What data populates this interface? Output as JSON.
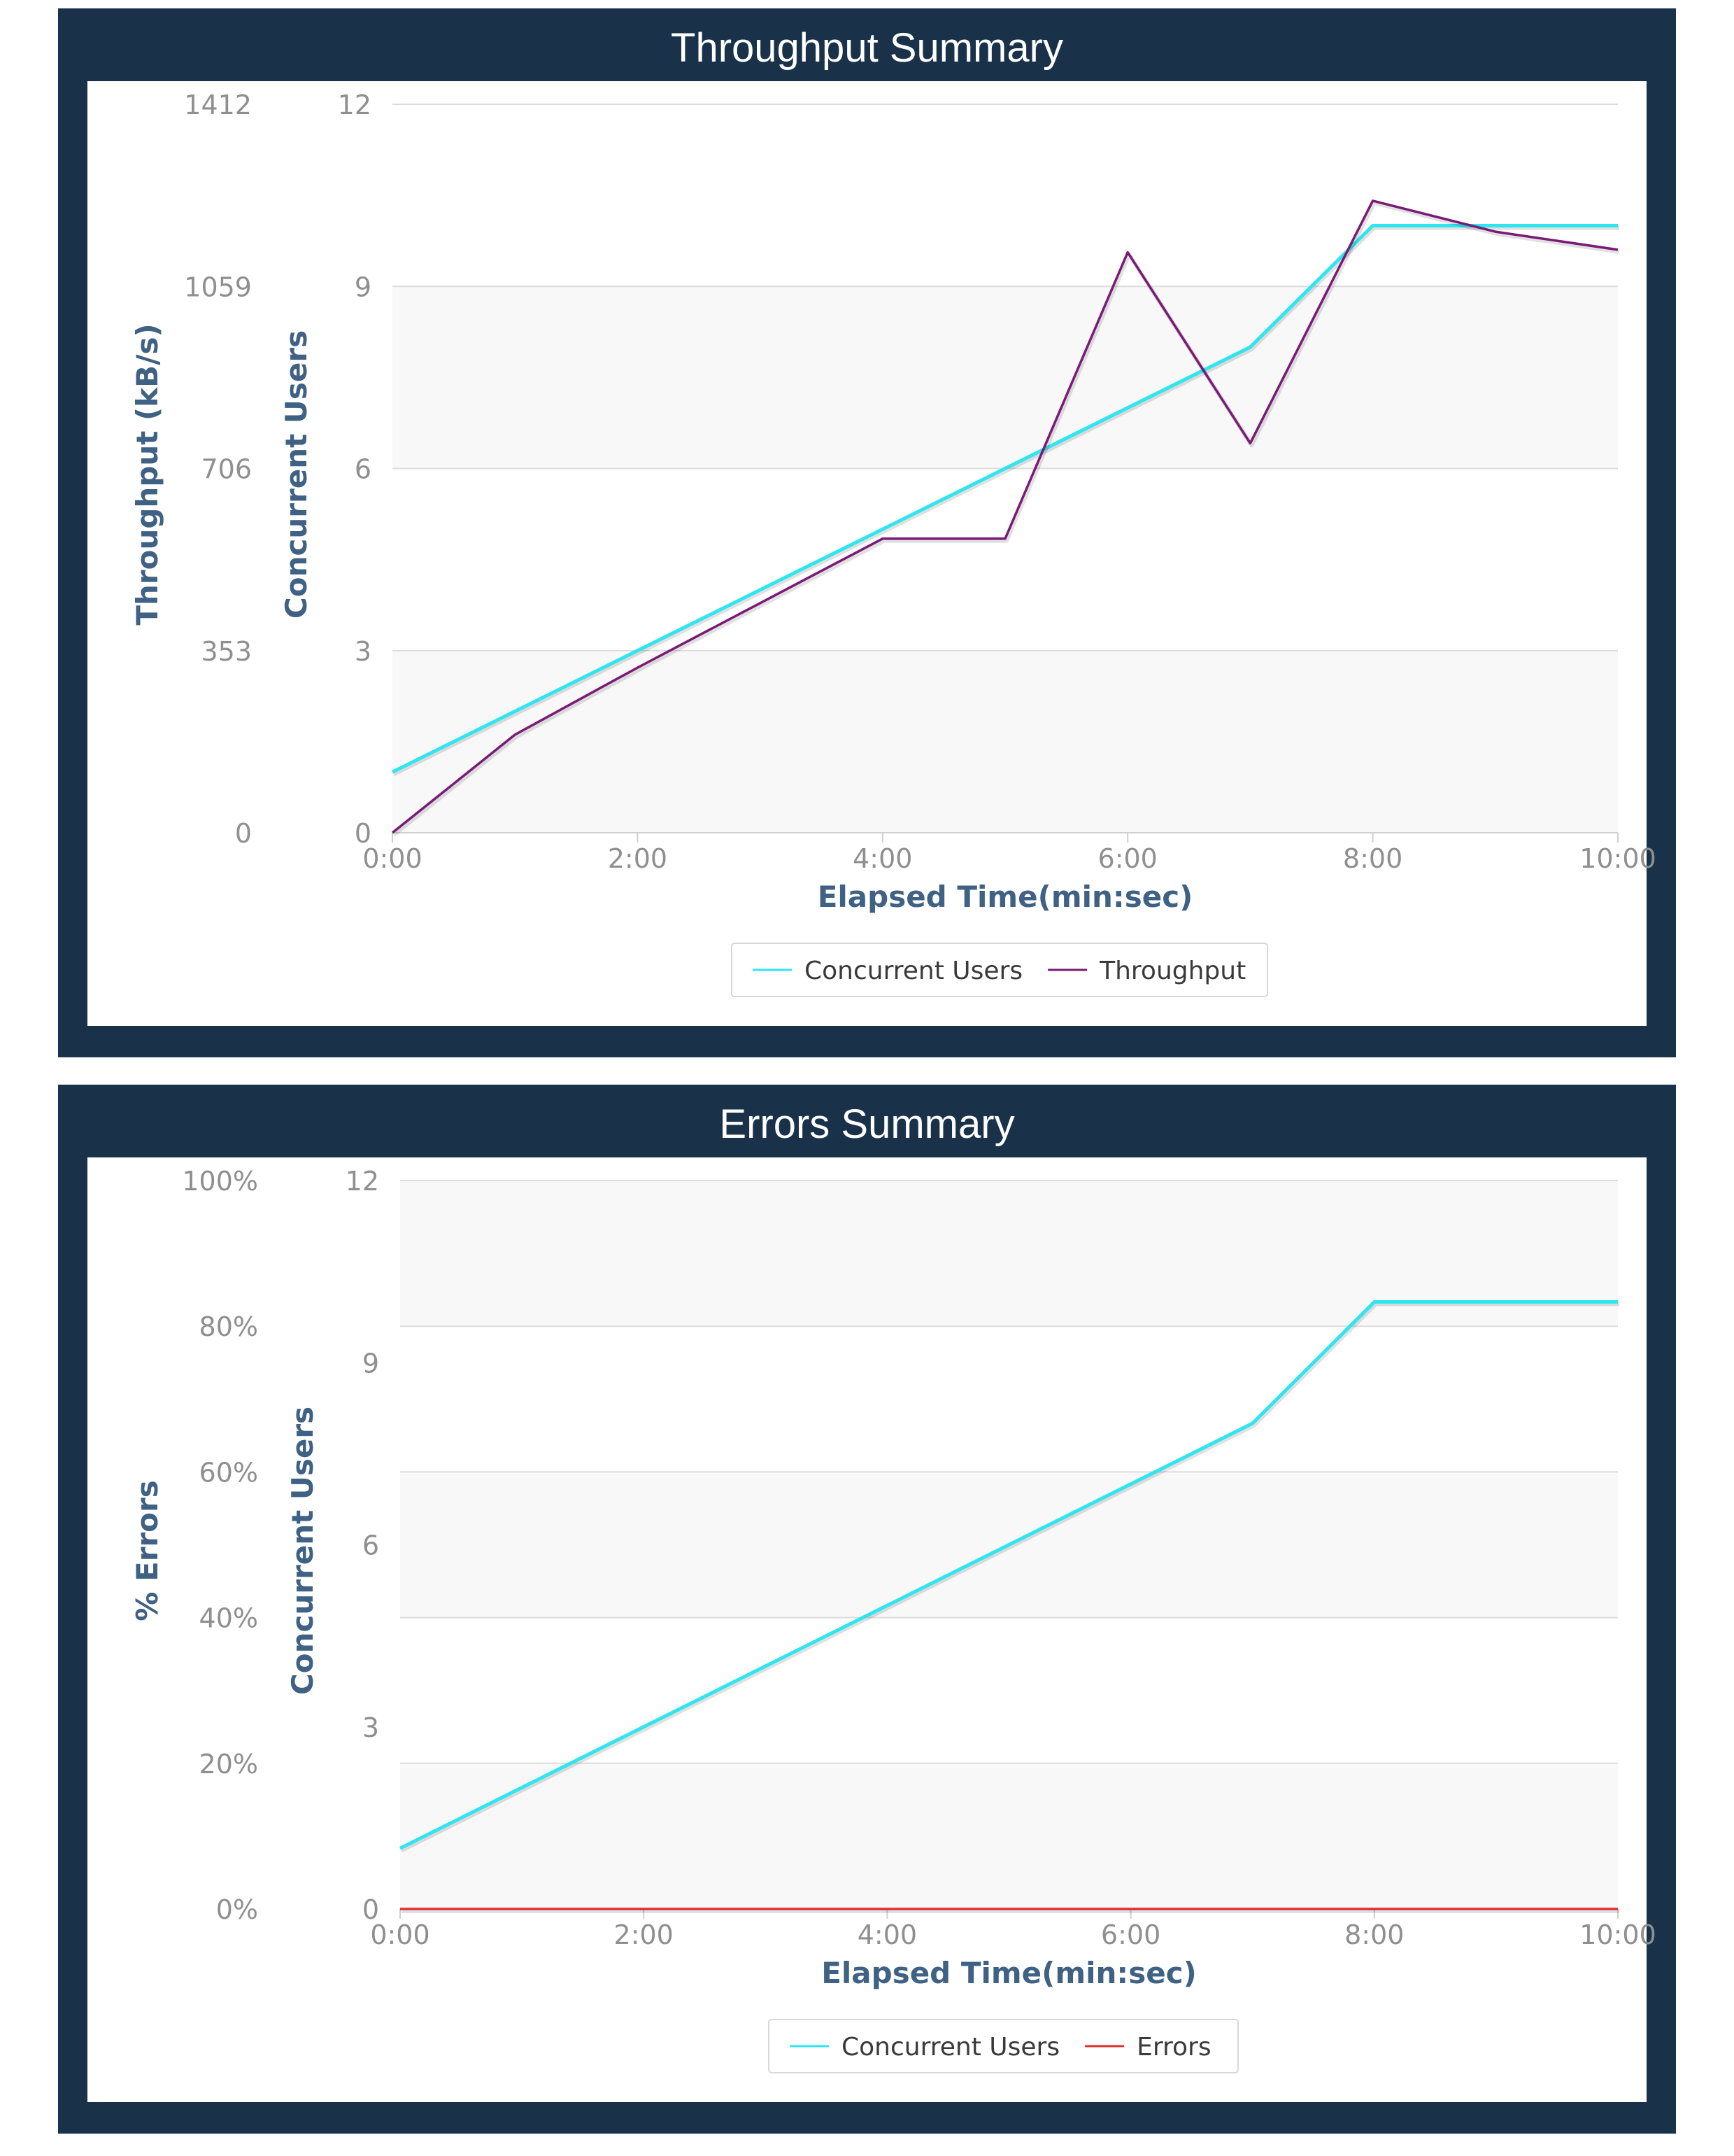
{
  "colors": {
    "panel_bg": "#19324a",
    "axis_title": "#3f6184",
    "tick": "#8f8f8f",
    "grid": "#dcdcdc",
    "band": "#f8f8f8",
    "concurrent_users": "#2fe6f0",
    "throughput": "#7a1a77",
    "errors": "#e03030"
  },
  "chart_data": [
    {
      "type": "line",
      "title": "Throughput Summary",
      "xlabel": "Elapsed Time(min:sec)",
      "x_ticks": [
        "0:00",
        "2:00",
        "4:00",
        "6:00",
        "8:00",
        "10:00"
      ],
      "xlim": [
        0,
        10
      ],
      "y_left_outer": {
        "label": "Throughput (kB/s)",
        "ticks": [
          "0",
          "353",
          "706",
          "1059",
          "1412"
        ],
        "ylim": [
          0,
          1412
        ]
      },
      "y_left_inner": {
        "label": "Concurrent Users",
        "ticks": [
          "0",
          "3",
          "6",
          "9",
          "12"
        ],
        "ylim": [
          0,
          12
        ]
      },
      "x": [
        0,
        1,
        2,
        3,
        4,
        5,
        6,
        7,
        8,
        9,
        10
      ],
      "series": [
        {
          "name": "Concurrent Users",
          "axis": "inner",
          "color": "#2fe6f0",
          "values": [
            1,
            2,
            3,
            4,
            5,
            6,
            7,
            8,
            10,
            10,
            10
          ]
        },
        {
          "name": "Throughput",
          "axis": "outer",
          "color": "#7a1a77",
          "values": [
            0,
            190,
            320,
            445,
            570,
            570,
            1125,
            755,
            1225,
            1165,
            1130
          ]
        }
      ],
      "legend": [
        "Concurrent Users",
        "Throughput"
      ],
      "legend_position": "bottom-center",
      "grid": true
    },
    {
      "type": "line",
      "title": "Errors Summary",
      "xlabel": "Elapsed Time(min:sec)",
      "x_ticks": [
        "0:00",
        "2:00",
        "4:00",
        "6:00",
        "8:00",
        "10:00"
      ],
      "xlim": [
        0,
        10
      ],
      "y_left_outer": {
        "label": "% Errors",
        "ticks": [
          "0%",
          "20%",
          "40%",
          "60%",
          "80%",
          "100%"
        ],
        "ylim": [
          0,
          100
        ]
      },
      "y_left_inner": {
        "label": "Concurrent Users",
        "ticks": [
          "0",
          "3",
          "6",
          "9",
          "12"
        ],
        "ylim": [
          0,
          12
        ]
      },
      "x": [
        0,
        1,
        2,
        3,
        4,
        5,
        6,
        7,
        8,
        9,
        10
      ],
      "series": [
        {
          "name": "Concurrent Users",
          "axis": "inner",
          "color": "#2fe6f0",
          "values": [
            1,
            2,
            3,
            4,
            5,
            6,
            7,
            8,
            10,
            10,
            10
          ]
        },
        {
          "name": "Errors",
          "axis": "outer",
          "color": "#e03030",
          "values": [
            0,
            0,
            0,
            0,
            0,
            0,
            0,
            0,
            0,
            0,
            0
          ]
        }
      ],
      "legend": [
        "Concurrent Users",
        "Errors"
      ],
      "legend_position": "bottom-center",
      "grid": true
    }
  ]
}
